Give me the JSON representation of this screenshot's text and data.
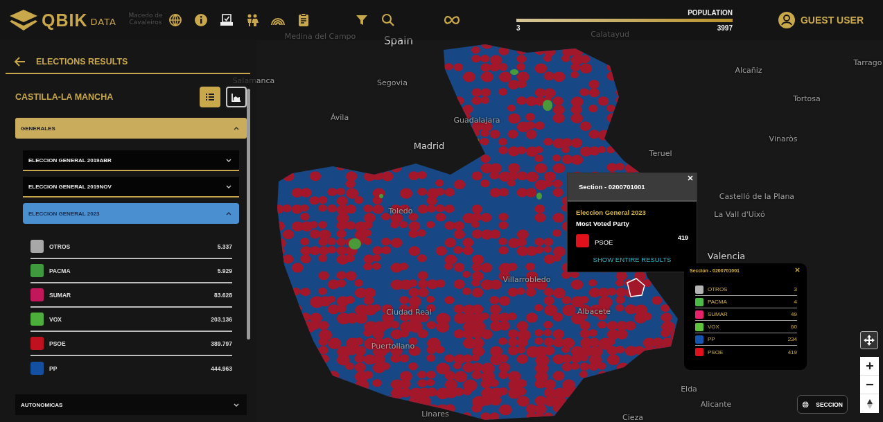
{
  "header": {
    "logo": {
      "mark": "QBIK",
      "suffix": "DATA"
    },
    "population": {
      "label": "POPULATION",
      "min": "3",
      "max": "3997",
      "level": 1
    },
    "user": {
      "name": "GUEST USER"
    }
  },
  "sidebar": {
    "title": "ELECTIONS RESULTS",
    "region": "CASTILLA-LA MANCHA",
    "views": [
      {
        "kind": "list",
        "selected": true
      },
      {
        "kind": "chart",
        "selected": false
      }
    ],
    "groups": [
      {
        "label": "GENERALES",
        "expanded": true,
        "elections": [
          {
            "label": "ELECCION GENERAL 2019ABR",
            "expanded": false
          },
          {
            "label": "ELECCION GENERAL 2019NOV",
            "expanded": false
          },
          {
            "label": "ELECCION GENERAL 2023",
            "expanded": true,
            "parties": [
              {
                "name": "OTROS",
                "votes": "5.337",
                "color": "#a8a8a8"
              },
              {
                "name": "PACMA",
                "votes": "5.929",
                "color": "#3e9a3c"
              },
              {
                "name": "SUMAR",
                "votes": "83.628",
                "color": "#c2185b"
              },
              {
                "name": "VOX",
                "votes": "203.136",
                "color": "#4caf3c"
              },
              {
                "name": "PSOE",
                "votes": "389.797",
                "color": "#c0111f"
              },
              {
                "name": "PP",
                "votes": "444.963",
                "color": "#1450a0"
              }
            ]
          }
        ]
      },
      {
        "label": "AUTONOMICAS",
        "expanded": false
      }
    ]
  },
  "map_labels": [
    {
      "text": "Spain",
      "kind": "country"
    },
    {
      "text": "Segovia",
      "kind": "city"
    },
    {
      "text": "Ávila",
      "kind": "city"
    },
    {
      "text": "Guadalajara",
      "kind": "city"
    },
    {
      "text": "Madrid",
      "kind": "capital"
    },
    {
      "text": "Toledo",
      "kind": "city"
    },
    {
      "text": "Teruel",
      "kind": "city"
    },
    {
      "text": "Castelló de la Plana",
      "kind": "city"
    },
    {
      "text": "La Vall d'Uixó",
      "kind": "city"
    },
    {
      "text": "Valencia",
      "kind": "capital"
    },
    {
      "text": "Villarrobledo",
      "kind": "city"
    },
    {
      "text": "Albacete",
      "kind": "city"
    },
    {
      "text": "Ciudad Real",
      "kind": "city"
    },
    {
      "text": "Puertollano",
      "kind": "city"
    },
    {
      "text": "Elda",
      "kind": "city"
    },
    {
      "text": "Alicante",
      "kind": "city"
    },
    {
      "text": "Cieza",
      "kind": "city"
    },
    {
      "text": "Linares",
      "kind": "city"
    },
    {
      "text": "Alcañiz",
      "kind": "city"
    },
    {
      "text": "Tortosa",
      "kind": "city"
    },
    {
      "text": "Vinaròs",
      "kind": "city"
    },
    {
      "text": "Tarrago",
      "kind": "city"
    },
    {
      "text": "Salamanca",
      "kind": "city"
    },
    {
      "text": "Medina del Campo",
      "kind": "city"
    },
    {
      "text": "Calatayud",
      "kind": "city"
    },
    {
      "text": "Macedo de Cavaleiros",
      "kind": "city"
    }
  ],
  "section_popup": {
    "title": "Section - 0200701001",
    "election": "Eleccion General 2023",
    "heading": "Most Voted Party",
    "party": {
      "name": "PSOE",
      "votes": "419",
      "color": "#e0101c"
    },
    "link": "SHOW ENTIRE RESULTS"
  },
  "results_popup": {
    "title": "Seccion - 0200701001",
    "rows": [
      {
        "name": "OTROS",
        "votes": "3",
        "color": "#b4b4b4"
      },
      {
        "name": "PACMA",
        "votes": "4",
        "color": "#4cbb46"
      },
      {
        "name": "SUMAR",
        "votes": "49",
        "color": "#e8216a"
      },
      {
        "name": "VOX",
        "votes": "60",
        "color": "#5ec23c"
      },
      {
        "name": "PP",
        "votes": "234",
        "color": "#1455b0"
      },
      {
        "name": "PSOE",
        "votes": "419",
        "color": "#e0101c"
      }
    ]
  },
  "map_controls": {
    "layer_button": "SECCION"
  }
}
